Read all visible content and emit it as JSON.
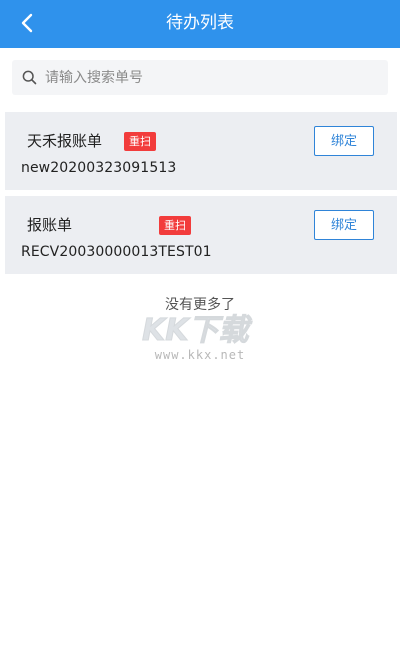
{
  "header": {
    "title": "待办列表",
    "back_icon": "chevron-left-icon",
    "background_color": "#2f92ec"
  },
  "search": {
    "placeholder": "请输入搜索单号",
    "value": "",
    "icon": "search-icon"
  },
  "items": [
    {
      "name": "天禾报账单",
      "badge": "重扫",
      "number": "new20200323091513",
      "action_label": "绑定"
    },
    {
      "name": "报账单",
      "badge": "重扫",
      "number": "RECV20030000013TEST01",
      "action_label": "绑定"
    }
  ],
  "footer_text": "没有更多了",
  "watermark": {
    "logo_text": "KK下载",
    "url": "www.kkx.net"
  },
  "colors": {
    "accent": "#2f92ec",
    "badge": "#f23c3c",
    "card_background": "#eceef2",
    "button_border": "#2f84d8"
  }
}
